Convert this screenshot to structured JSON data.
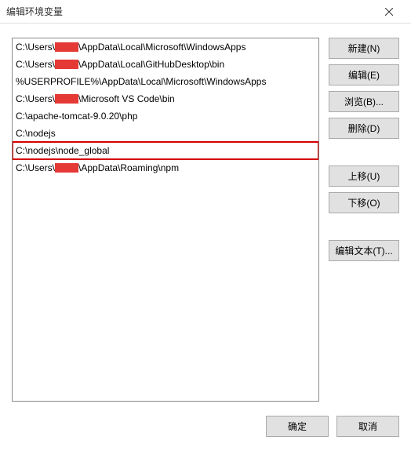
{
  "titlebar": {
    "title": "编辑环境变量"
  },
  "list": {
    "items": [
      {
        "prefix": "C:\\Users\\",
        "redact_w": 30,
        "suffix": "\\AppData\\Local\\Microsoft\\WindowsApps",
        "highlighted": false
      },
      {
        "prefix": "C:\\Users\\",
        "redact_w": 30,
        "suffix": "\\AppData\\Local\\GitHubDesktop\\bin",
        "highlighted": false
      },
      {
        "prefix": "%USERPROFILE%\\AppData\\Local\\Microsoft\\WindowsApps",
        "redact_w": 0,
        "suffix": "",
        "highlighted": false
      },
      {
        "prefix": "C:\\Users\\",
        "redact_w": 30,
        "suffix": "\\Microsoft VS Code\\bin",
        "highlighted": false
      },
      {
        "prefix": "C:\\apache-tomcat-9.0.20\\php",
        "redact_w": 0,
        "suffix": "",
        "highlighted": false
      },
      {
        "prefix": "C:\\nodejs",
        "redact_w": 0,
        "suffix": "",
        "highlighted": false
      },
      {
        "prefix": "C:\\nodejs\\node_global",
        "redact_w": 0,
        "suffix": "",
        "highlighted": true
      },
      {
        "prefix": "C:\\Users\\",
        "redact_w": 30,
        "suffix": "\\AppData\\Roaming\\npm",
        "highlighted": false
      }
    ]
  },
  "buttons": {
    "new": "新建(N)",
    "edit": "编辑(E)",
    "browse": "浏览(B)...",
    "delete": "删除(D)",
    "move_up": "上移(U)",
    "move_down": "下移(O)",
    "edit_text": "编辑文本(T)...",
    "ok": "确定",
    "cancel": "取消"
  }
}
